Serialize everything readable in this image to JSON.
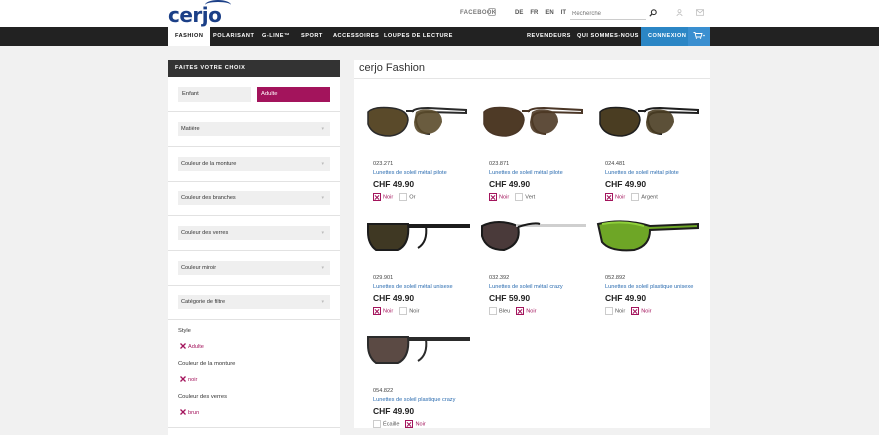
{
  "brand": {
    "logo_text": "cerjo"
  },
  "topbar": {
    "facebook_label": "FACEBOOK",
    "languages": [
      "DE",
      "FR",
      "EN",
      "IT"
    ],
    "search_placeholder": "Recherche"
  },
  "nav": {
    "items": [
      "Fashion",
      "Polarisant",
      "G-Line™",
      "Sport",
      "Accessoires",
      "Loupes de lecture"
    ],
    "active": "Fashion",
    "right_items": [
      "Revendeurs",
      "Qui sommes-nous ?",
      "Connexion"
    ]
  },
  "sidebar": {
    "header": "Faites votre choix",
    "choices": [
      "Enfant",
      "Adulte"
    ],
    "selected_choice": "Adulte",
    "filters": [
      "Matière",
      "Couleur de la monture",
      "Couleur des branches",
      "Couleur des verres",
      "Couleur miroir",
      "Catégorie de filtre"
    ],
    "selections": [
      {
        "title": "Style",
        "value": "Adulte"
      },
      {
        "title": "Couleur de la monture",
        "value": "noir"
      },
      {
        "title": "Couleur des verres",
        "value": "brun"
      }
    ]
  },
  "main": {
    "title": "cerjo Fashion",
    "products": [
      {
        "ref": "023.271",
        "desc": "Lunettes de soleil métal pilote",
        "price": "CHF 49.90",
        "swatches": [
          {
            "label": "Noir",
            "on": true
          },
          {
            "label": "Or",
            "on": false
          }
        ],
        "frame_color": "#2a2a2a",
        "lens_color": "#5a4a2a",
        "style": "pilot"
      },
      {
        "ref": "023.871",
        "desc": "Lunettes de soleil métal pilote",
        "price": "CHF 49.90",
        "swatches": [
          {
            "label": "Noir",
            "on": true
          },
          {
            "label": "Vert",
            "on": false
          }
        ],
        "frame_color": "#4a3626",
        "lens_color": "#4e3a26",
        "style": "pilot"
      },
      {
        "ref": "024.481",
        "desc": "Lunettes de soleil métal pilote",
        "price": "CHF 49.90",
        "swatches": [
          {
            "label": "Noir",
            "on": true
          },
          {
            "label": "Argent",
            "on": false
          }
        ],
        "frame_color": "#1e1e1e",
        "lens_color": "#4a3d22",
        "style": "pilot"
      },
      {
        "ref": "029.901",
        "desc": "Lunettes de soleil métal unisexe",
        "price": "CHF 49.90",
        "swatches": [
          {
            "label": "Noir",
            "on": true
          },
          {
            "label": "Noir",
            "on": false
          }
        ],
        "frame_color": "#1c1c1c",
        "lens_color": "#3f3823",
        "style": "square"
      },
      {
        "ref": "032.392",
        "desc": "Lunettes de soleil métal crazy",
        "price": "CHF 59.90",
        "swatches": [
          {
            "label": "Bleu",
            "on": false
          },
          {
            "label": "Noir",
            "on": true
          }
        ],
        "frame_color": "#1a1a1a",
        "lens_color": "#4a3a3a",
        "style": "cat"
      },
      {
        "ref": "052.892",
        "desc": "Lunettes de soleil plastique unisexe",
        "price": "CHF 49.90",
        "swatches": [
          {
            "label": "Noir",
            "on": false
          },
          {
            "label": "Noir",
            "on": true
          }
        ],
        "frame_color": "#1d1d1d",
        "lens_color": "#6ea626",
        "style": "sport"
      },
      {
        "ref": "054.822",
        "desc": "Lunettes de soleil plastique crazy",
        "price": "CHF 49.90",
        "swatches": [
          {
            "label": "Écaille",
            "on": false
          },
          {
            "label": "Noir",
            "on": true
          }
        ],
        "frame_color": "#2b2b2b",
        "lens_color": "#5b4a44",
        "style": "square"
      }
    ]
  },
  "colors": {
    "accent": "#a3145c",
    "nav_bg": "#222222",
    "connexion_bg": "#2b86c5"
  }
}
